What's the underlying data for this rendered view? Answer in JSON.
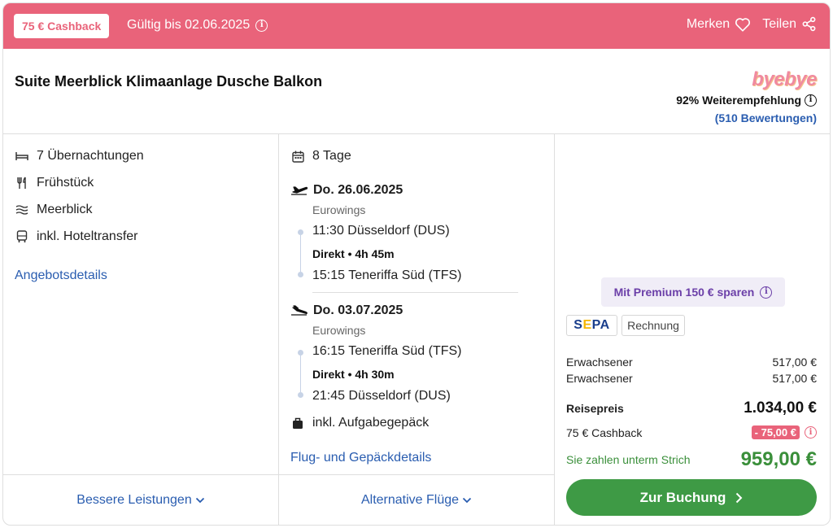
{
  "header": {
    "cashback_badge": "75 € Cashback",
    "valid_until": "Gültig bis 02.06.2025",
    "save_label": "Merken",
    "share_label": "Teilen",
    "color": "#e9637a"
  },
  "hotel": {
    "title": "Suite Meerblick Klimaanlage Dusche Balkon",
    "brand": "byebye",
    "recommendation": "92% Weiterempfehlung",
    "reviews": "(510 Bewertungen)"
  },
  "features": {
    "items": [
      {
        "label": "7 Übernachtungen",
        "icon": "bed-icon"
      },
      {
        "label": "Frühstück",
        "icon": "cutlery-icon"
      },
      {
        "label": "Meerblick",
        "icon": "waves-icon"
      },
      {
        "label": "inkl. Hoteltransfer",
        "icon": "bus-icon"
      }
    ],
    "details_link": "Angebotsdetails",
    "footer_link": "Bessere Leistungen"
  },
  "flights": {
    "duration": "8 Tage",
    "outbound": {
      "date": "Do. 26.06.2025",
      "airline": "Eurowings",
      "depart": "11:30 Düsseldorf (DUS)",
      "direct": "Direkt • 4h 45m",
      "arrive": "15:15 Teneriffa Süd (TFS)"
    },
    "return": {
      "date": "Do. 03.07.2025",
      "airline": "Eurowings",
      "depart": "16:15 Teneriffa Süd (TFS)",
      "direct": "Direkt • 4h 30m",
      "arrive": "21:45 Düsseldorf (DUS)"
    },
    "baggage": "inkl. Aufgabegepäck",
    "details_link": "Flug- und Gepäckdetails",
    "footer_link": "Alternative Flüge"
  },
  "pricing": {
    "premium": "Mit Premium 150 € sparen",
    "payment_sepa": "SEPA",
    "payment_invoice": "Rechnung",
    "travellers": [
      {
        "label": "Erwachsener",
        "price": "517,00 €"
      },
      {
        "label": "Erwachsener",
        "price": "517,00 €"
      }
    ],
    "total_label": "Reisepreis",
    "total_price": "1.034,00 €",
    "cashback_label": "75 € Cashback",
    "cashback_value": "- 75,00 €",
    "final_label": "Sie zahlen unterm Strich",
    "final_price": "959,00 €",
    "book_label": "Zur Buchung",
    "button_color": "#3e9a45"
  }
}
